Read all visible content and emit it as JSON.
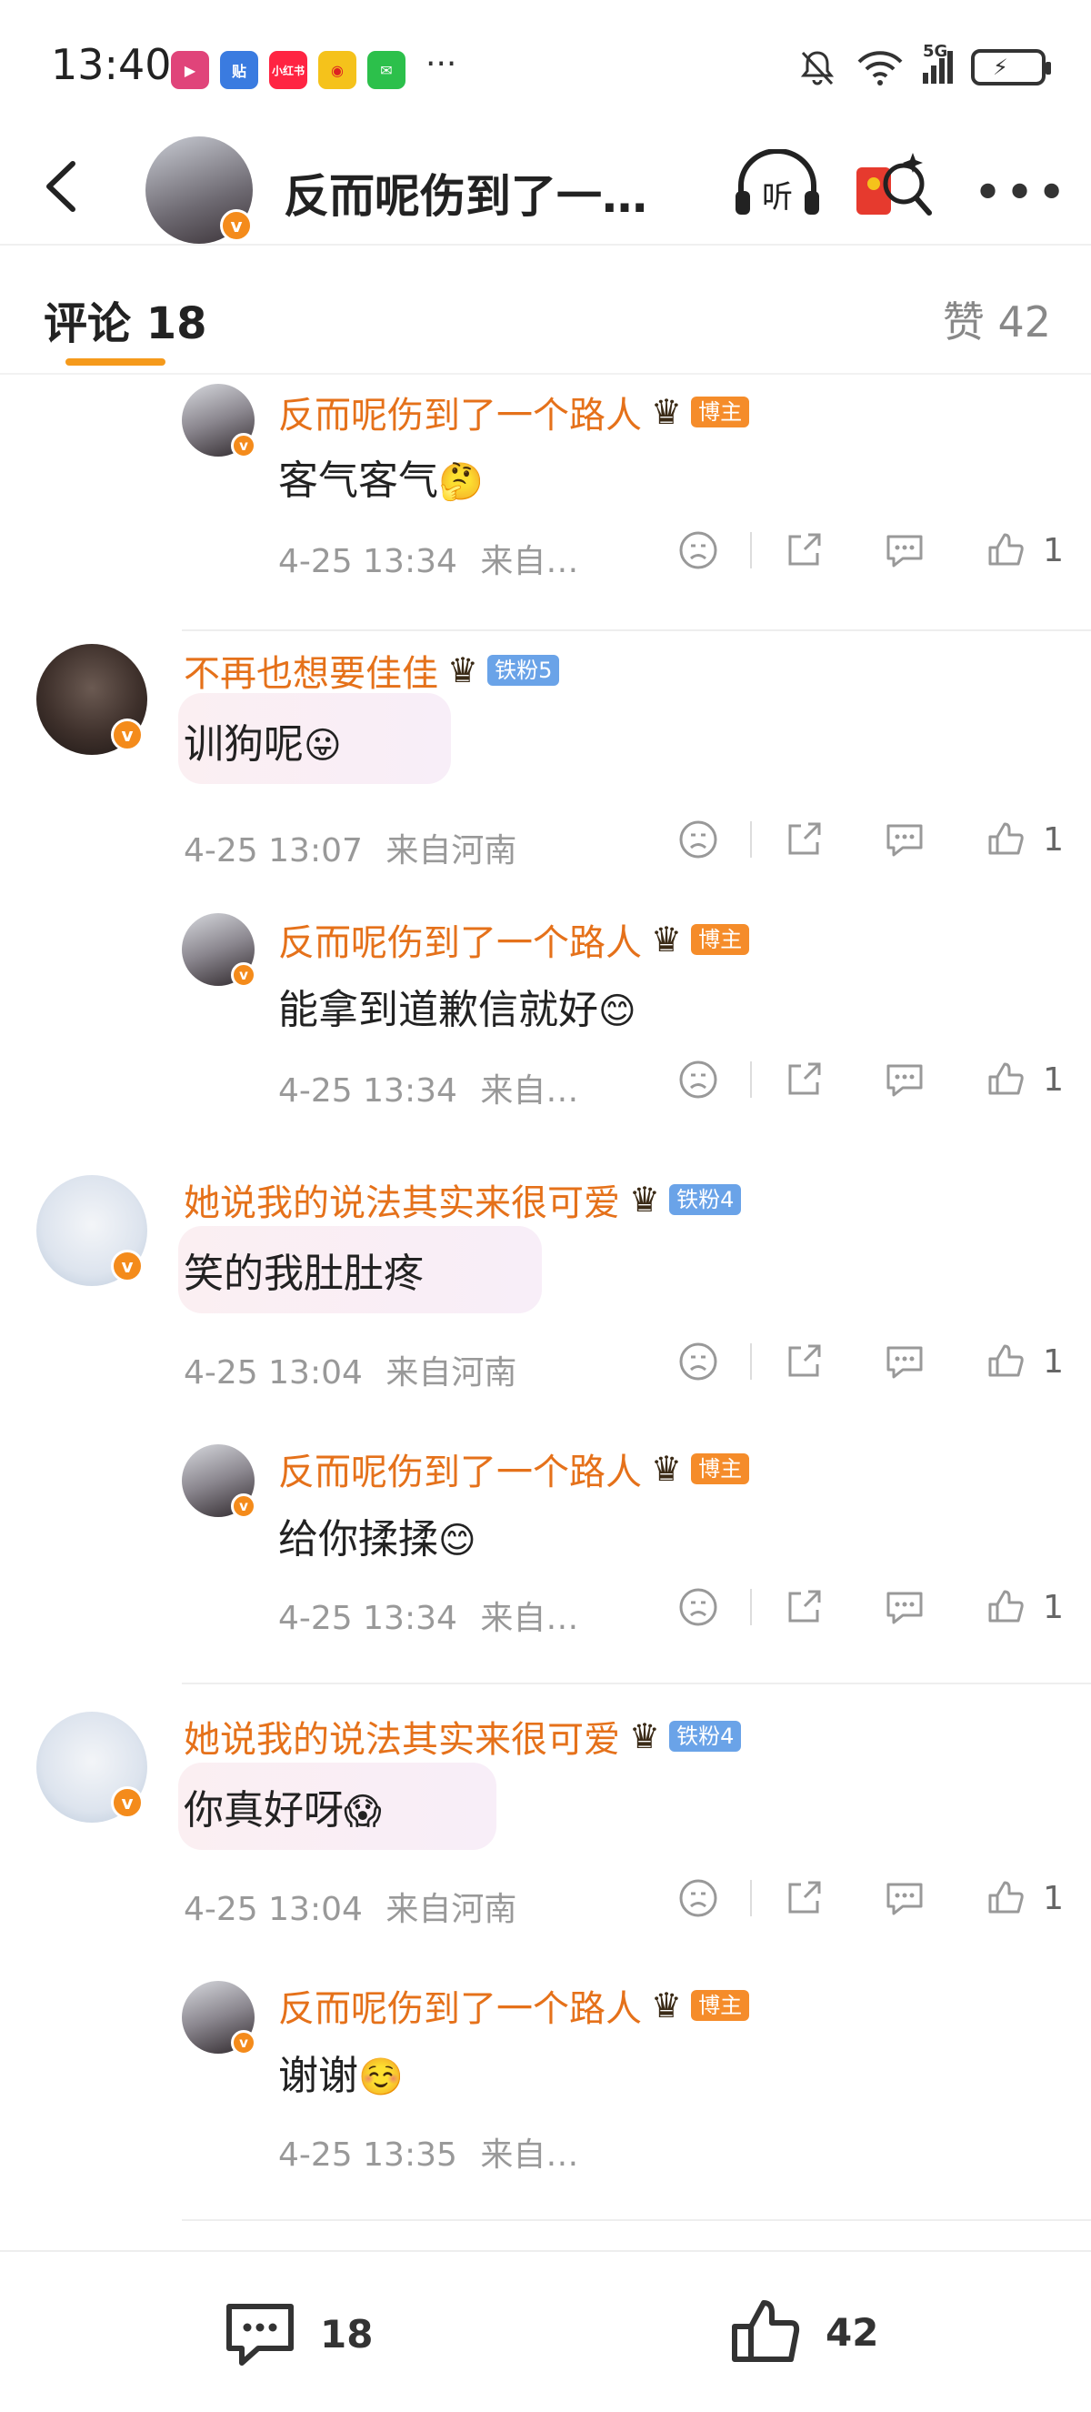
{
  "status_bar": {
    "time": "13:40",
    "apps": [
      {
        "icon": "video-app-icon",
        "color": "#e0447a"
      },
      {
        "icon": "tieba-app-icon",
        "text": "贴",
        "color": "#3a7be0"
      },
      {
        "icon": "xiaohongshu-app-icon",
        "text": "小红书",
        "color": "#ff2442"
      },
      {
        "icon": "weibo-app-icon",
        "color": "#f5c21b"
      },
      {
        "icon": "wechat-app-icon",
        "color": "#2cc04b"
      }
    ],
    "more": "···",
    "network": "5G"
  },
  "header": {
    "title": "反而呢伤到了一个…",
    "listen_label": "听"
  },
  "tabs": {
    "comments_label": "评论 18",
    "likes_label": "赞 42"
  },
  "comments": [
    {
      "username": "反而呢伤到了一个路人",
      "badge": "博主",
      "text": "客气客气",
      "emoji": "🤔",
      "time": "4-25 13:34",
      "location": "来自…",
      "likes": "1"
    },
    {
      "username": "不再也想要佳佳",
      "badge": "铁粉5",
      "text": "训狗呢",
      "emoji": "😛",
      "time": "4-25 13:07",
      "location": "来自河南",
      "likes": "1"
    },
    {
      "username": "反而呢伤到了一个路人",
      "badge": "博主",
      "text": "能拿到道歉信就好",
      "emoji": "😊",
      "time": "4-25 13:34",
      "location": "来自…",
      "likes": "1"
    },
    {
      "username": "她说我的说法其实来很可爱",
      "badge": "铁粉4",
      "text": "笑的我肚肚疼",
      "emoji": "",
      "time": "4-25 13:04",
      "location": "来自河南",
      "likes": "1"
    },
    {
      "username": "反而呢伤到了一个路人",
      "badge": "博主",
      "text": "给你揉揉",
      "emoji": "😊",
      "time": "4-25 13:34",
      "location": "来自…",
      "likes": "1"
    },
    {
      "username": "她说我的说法其实来很可爱",
      "badge": "铁粉4",
      "text": "你真好呀",
      "emoji": "😱",
      "time": "4-25 13:04",
      "location": "来自河南",
      "likes": "1"
    },
    {
      "username": "反而呢伤到了一个路人",
      "badge": "博主",
      "text": "谢谢",
      "emoji": "☺️",
      "time": "4-25 13:35",
      "location": "来自…",
      "likes": ""
    }
  ],
  "bottom_bar": {
    "comment_count": "18",
    "like_count": "42"
  },
  "colors": {
    "username": "#e5711a",
    "host_badge": "#f58c2a",
    "fan_badge": "#6aa3e8",
    "tab_underline": "#f59a1c"
  }
}
